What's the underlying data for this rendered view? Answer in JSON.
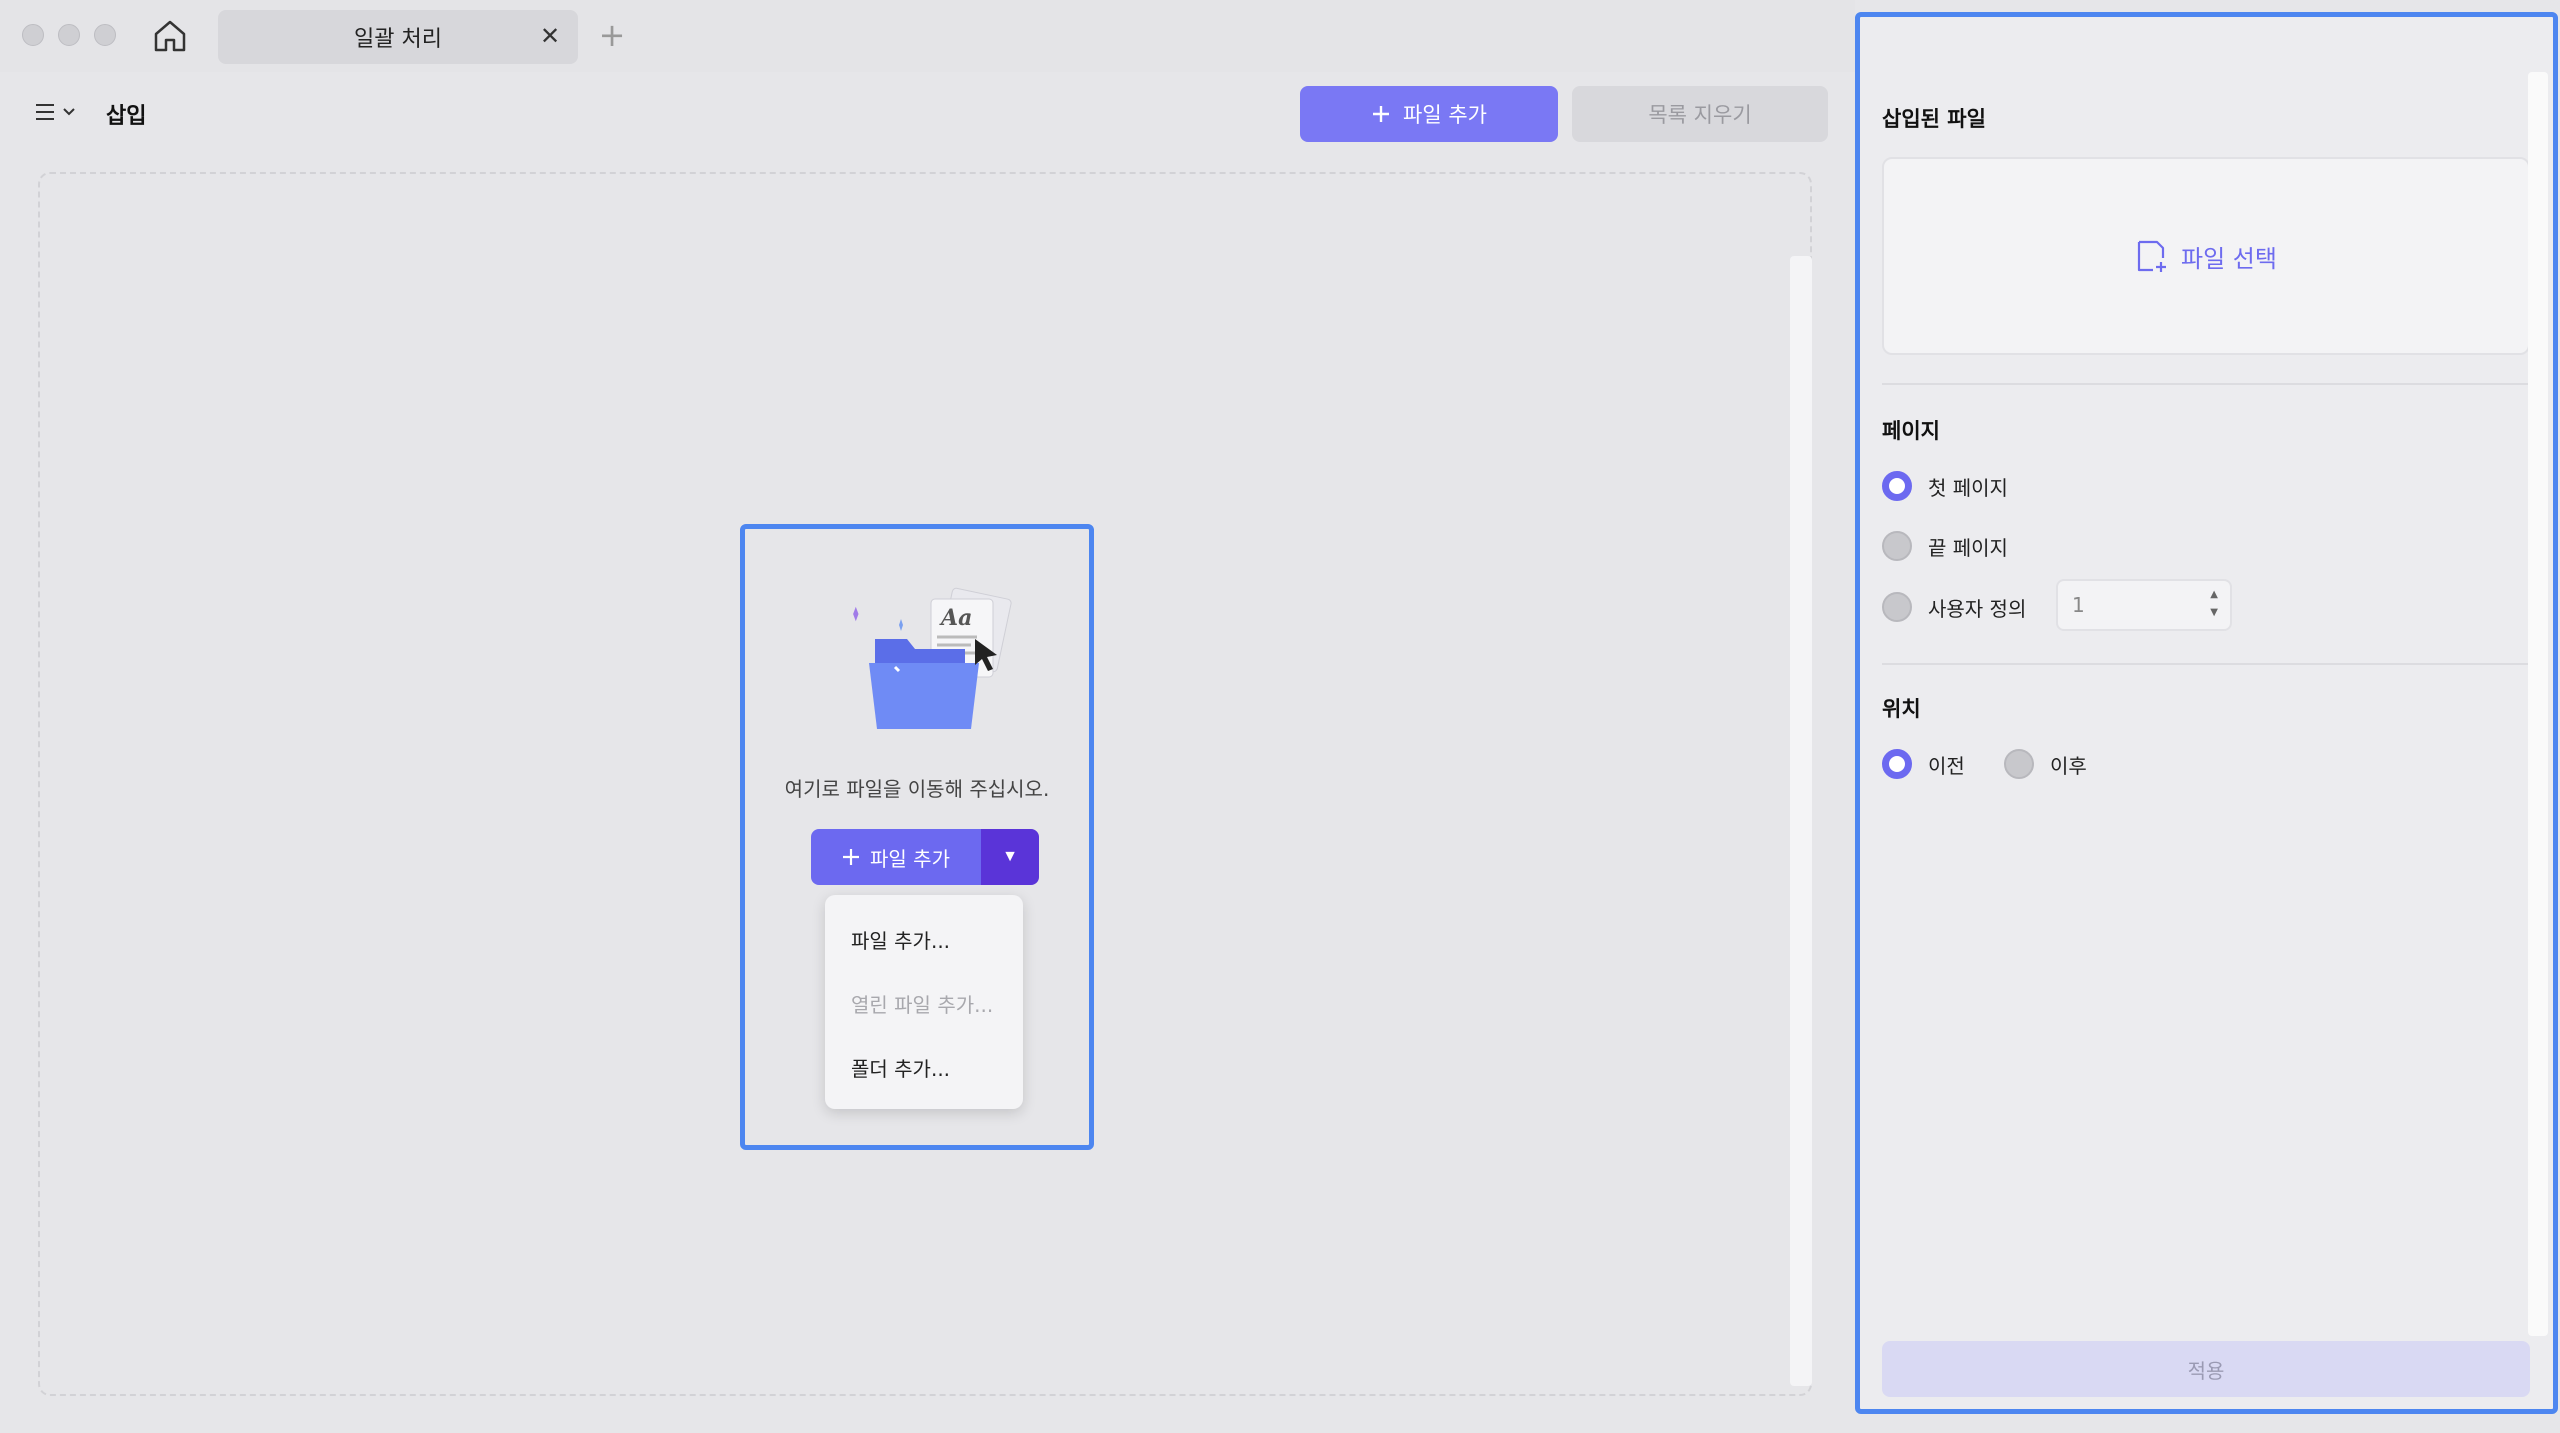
{
  "tab": {
    "title": "일괄 처리",
    "close": "✕",
    "new": "+"
  },
  "main": {
    "title": "삽입",
    "add_file_button": "파일 추가",
    "clear_list_button": "목록 지우기",
    "drop_text": "여기로 파일을 이동해 주십시오.",
    "split_button_label": "파일 추가",
    "dropdown_items": [
      {
        "label": "파일 추가...",
        "disabled": false
      },
      {
        "label": "열린 파일 추가...",
        "disabled": true
      },
      {
        "label": "폴더 추가...",
        "disabled": false
      }
    ]
  },
  "panel": {
    "inserted_file_label": "삽입된 파일",
    "file_select_label": "파일 선택",
    "page_label": "페이지",
    "page_options": [
      {
        "label": "첫 페이지",
        "checked": true
      },
      {
        "label": "끝 페이지",
        "checked": false
      },
      {
        "label": "사용자 정의",
        "checked": false
      }
    ],
    "custom_page_value": "1",
    "position_label": "위치",
    "position_options": [
      {
        "label": "이전",
        "checked": true
      },
      {
        "label": "이후",
        "checked": false
      }
    ],
    "apply_button": "적용"
  },
  "colors": {
    "accent": "#6c69f0",
    "highlight": "#4d86f0"
  }
}
